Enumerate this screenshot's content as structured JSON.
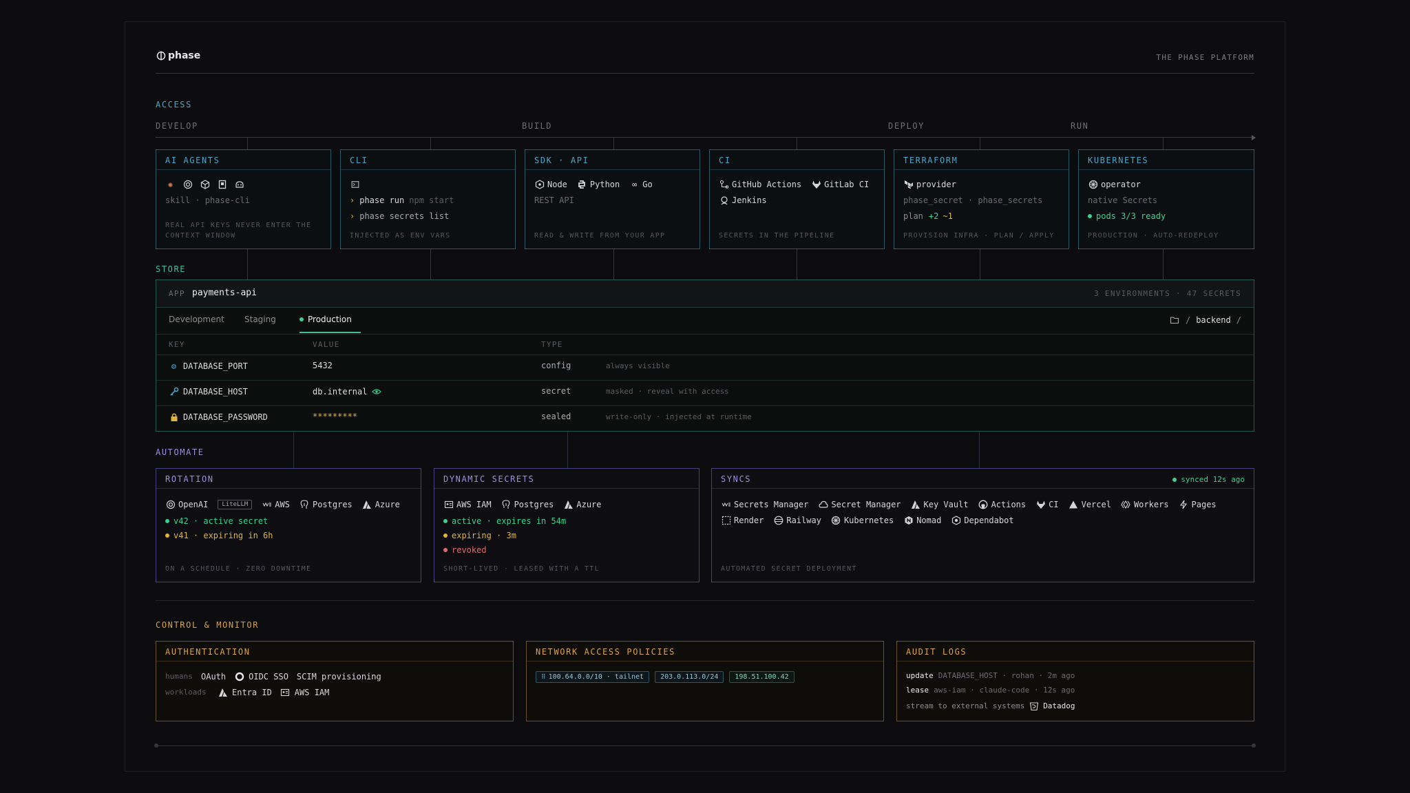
{
  "header": {
    "logo_text": "phase",
    "tagline": "THE PHASE PLATFORM"
  },
  "sections": {
    "access": "ACCESS",
    "store": "STORE",
    "automate": "AUTOMATE",
    "control": "CONTROL & MONITOR"
  },
  "stages": [
    "DEVELOP",
    "BUILD",
    "DEPLOY",
    "RUN"
  ],
  "access_cards": {
    "ai_agents": {
      "title": "AI AGENTS",
      "line": "skill · phase-cli",
      "foot1": "REAL API KEYS NEVER ENTER THE",
      "foot2": "CONTEXT WINDOW"
    },
    "cli": {
      "title": "CLI",
      "cmd1": "phase run",
      "cmd1_arg": "npm start",
      "cmd2": "phase secrets list",
      "foot": "INJECTED AS ENV VARS"
    },
    "sdk": {
      "title": "SDK · API",
      "items": [
        "Node",
        "Python",
        "Go"
      ],
      "line": "REST API",
      "foot": "READ & WRITE FROM YOUR APP"
    },
    "ci": {
      "title": "CI",
      "items": [
        "GitHub Actions",
        "GitLab CI",
        "Jenkins"
      ],
      "foot": "SECRETS IN THE PIPELINE"
    },
    "terraform": {
      "title": "TERRAFORM",
      "item": "provider",
      "line": "phase_secret · phase_secrets",
      "plan_label": "plan",
      "plan_add": "+2",
      "plan_del": "~1",
      "foot": "PROVISION INFRA · PLAN / APPLY"
    },
    "kubernetes": {
      "title": "KUBERNETES",
      "item": "operator",
      "line": "native Secrets",
      "status": "pods 3/3 ready",
      "foot": "PRODUCTION · AUTO-REDEPLOY"
    }
  },
  "store": {
    "app_label": "APP",
    "app_name": "payments-api",
    "summary": "3 ENVIRONMENTS · 47 SECRETS",
    "tabs": [
      "Development",
      "Staging",
      "Production"
    ],
    "path_sep": "/",
    "path_folder": "backend",
    "columns": [
      "KEY",
      "VALUE",
      "TYPE"
    ],
    "rows": [
      {
        "key": "DATABASE_PORT",
        "value": "5432",
        "type": "config",
        "note": "always visible"
      },
      {
        "key": "DATABASE_HOST",
        "value": "db.internal",
        "type": "secret",
        "note": "masked · reveal with access"
      },
      {
        "key": "DATABASE_PASSWORD",
        "value": "*********",
        "type": "sealed",
        "note": "write-only · injected at runtime"
      }
    ]
  },
  "automate": {
    "rotation": {
      "title": "ROTATION",
      "items": [
        "OpenAI",
        "LiteLLM",
        "AWS",
        "Postgres",
        "Azure"
      ],
      "status1": "v42 · active secret",
      "status2": "v41 · expiring in 6h",
      "foot": "ON A SCHEDULE · ZERO DOWNTIME"
    },
    "dynamic": {
      "title": "DYNAMIC SECRETS",
      "items": [
        "AWS IAM",
        "Postgres",
        "Azure"
      ],
      "status1": "active · expires in 54m",
      "status2": "expiring · 3m",
      "status3": "revoked",
      "foot": "SHORT-LIVED · LEASED WITH A TTL"
    },
    "syncs": {
      "title": "SYNCS",
      "status": "synced 12s ago",
      "row1": [
        "Secrets Manager",
        "Secret Manager",
        "Key Vault",
        "Actions",
        "CI",
        "Vercel",
        "Workers",
        "Pages"
      ],
      "row2": [
        "Render",
        "Railway",
        "Kubernetes",
        "Nomad",
        "Dependabot"
      ],
      "foot": "AUTOMATED SECRET DEPLOYMENT"
    }
  },
  "control": {
    "auth": {
      "title": "AUTHENTICATION",
      "humans_label": "humans",
      "humans": [
        "OAuth",
        "OIDC SSO",
        "SCIM provisioning"
      ],
      "workloads_label": "workloads",
      "workloads": [
        "Entra ID",
        "AWS IAM"
      ]
    },
    "network": {
      "title": "NETWORK ACCESS POLICIES",
      "cidrs": [
        "100.64.0.0/10 · tailnet",
        "203.0.113.0/24",
        "198.51.100.42"
      ]
    },
    "audit": {
      "title": "AUDIT LOGS",
      "log1_action": "update",
      "log1_rest": "DATABASE_HOST · rohan · 2m ago",
      "log2_action": "lease",
      "log2_rest": "aws-iam · claude-code · 12s ago",
      "stream_label": "stream to external systems",
      "stream_target": "Datadog"
    }
  },
  "colors": {
    "access": "#4ea3c7",
    "store": "#3fbf9a",
    "automate": "#9a8fe0",
    "control": "#d8a24a",
    "green": "#3fd08f",
    "yellow": "#e0b43a",
    "red": "#e06a6a"
  }
}
